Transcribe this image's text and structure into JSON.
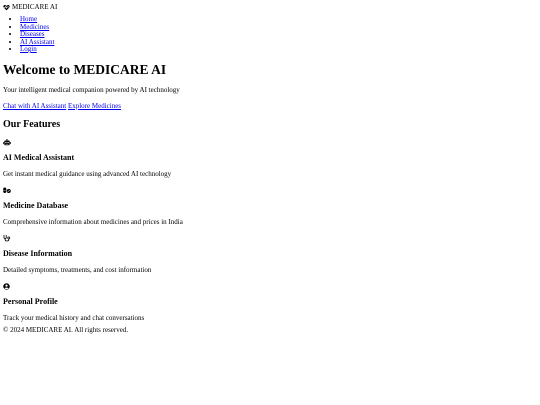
{
  "header": {
    "brand_icon": "heart-pulse-icon",
    "brand_name": "MEDICARE AI"
  },
  "nav": {
    "items": [
      {
        "label": "Home"
      },
      {
        "label": "Medicines"
      },
      {
        "label": "Diseases"
      },
      {
        "label": "AI Assistant"
      },
      {
        "label": "Login"
      }
    ]
  },
  "hero": {
    "title": "Welcome to MEDICARE AI",
    "subtitle": "Your intelligent medical companion powered by AI technology",
    "cta_primary": "Chat with AI Assistant",
    "cta_secondary": "Explore Medicines"
  },
  "features": {
    "heading": "Our Features",
    "items": [
      {
        "icon": "robot-icon",
        "title": "AI Medical Assistant",
        "description": "Get instant medical guidance using advanced AI technology"
      },
      {
        "icon": "pills-icon",
        "title": "Medicine Database",
        "description": "Comprehensive information about medicines and prices in India"
      },
      {
        "icon": "stethoscope-icon",
        "title": "Disease Information",
        "description": "Detailed symptoms, treatments, and cost information"
      },
      {
        "icon": "user-circle-icon",
        "title": "Personal Profile",
        "description": "Track your medical history and chat conversations"
      }
    ]
  },
  "footer": {
    "copyright": "© 2024 MEDICARE AI. All rights reserved."
  }
}
